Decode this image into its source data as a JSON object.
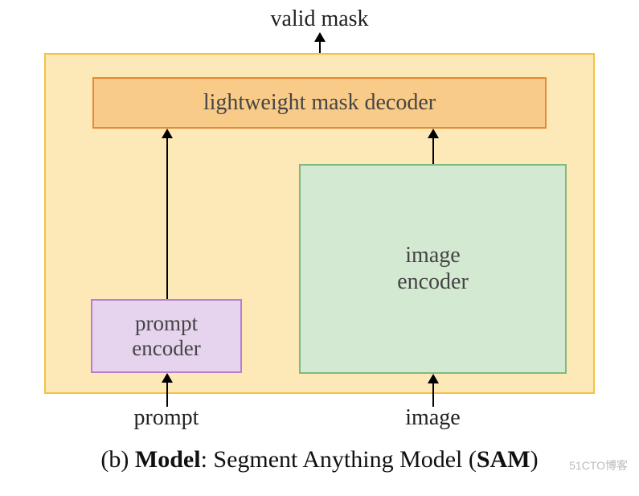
{
  "labels": {
    "top": "valid mask",
    "decoder": "lightweight mask decoder",
    "prompt_encoder_l1": "prompt",
    "prompt_encoder_l2": "encoder",
    "image_encoder_l1": "image",
    "image_encoder_l2": "encoder",
    "prompt": "prompt",
    "image": "image"
  },
  "caption": {
    "prefix": "(b) ",
    "bold1": "Model",
    "mid": ": Segment Anything Model (",
    "bold2": "SAM",
    "suffix": ")"
  },
  "watermark": "51CTO博客"
}
